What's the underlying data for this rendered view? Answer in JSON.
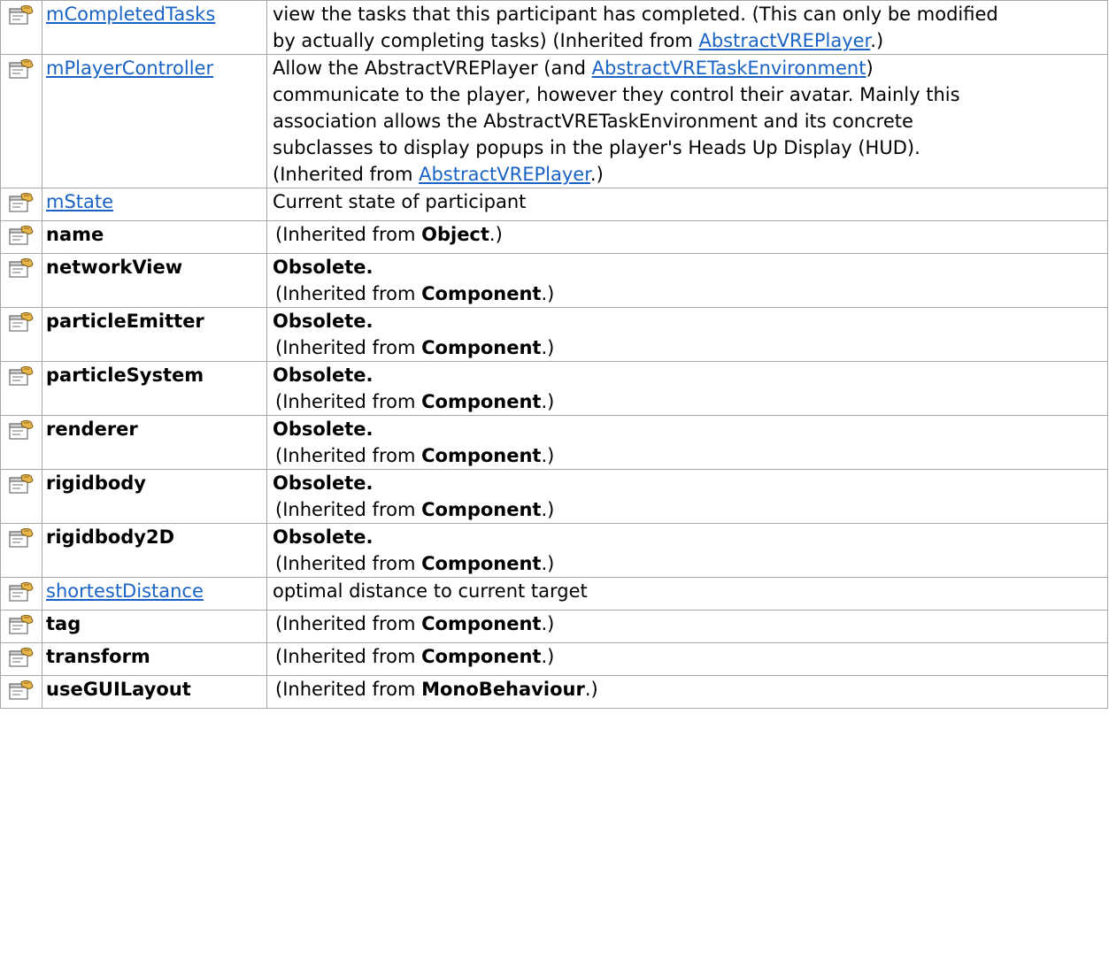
{
  "rows": [
    {
      "name": "mCompletedTasks",
      "link": true,
      "lines": [
        "view the tasks that this participant has completed. (This can only be modified",
        "by actually completing tasks) (Inherited from "
      ],
      "inherited_from": "AbstractVREPlayer",
      "inherited_link": true,
      "inherit_style": "inline-last"
    },
    {
      "name": "mPlayerController",
      "link": true,
      "lines": [
        "Allow the AbstractVREPlayer (and ",
        "communicate to the player, however they control their avatar. Mainly this",
        "association allows the AbstractVRETaskEnvironment and its concrete",
        "subclasses to display popups in the player's Heads Up Display (HUD).",
        "(Inherited from "
      ],
      "inline_link": "AbstractVRETaskEnvironment",
      "inherited_from": "AbstractVREPlayer",
      "inherited_link": true,
      "inherit_style": "special"
    },
    {
      "name": "mState",
      "link": true,
      "lines": [
        "Current state of participant"
      ]
    },
    {
      "name": "name",
      "link": false,
      "obsolete": false,
      "inherited_from": "Object"
    },
    {
      "name": "networkView",
      "link": false,
      "obsolete": true,
      "inherited_from": "Component"
    },
    {
      "name": "particleEmitter",
      "link": false,
      "obsolete": true,
      "inherited_from": "Component"
    },
    {
      "name": "particleSystem",
      "link": false,
      "obsolete": true,
      "inherited_from": "Component"
    },
    {
      "name": "renderer",
      "link": false,
      "obsolete": true,
      "inherited_from": "Component"
    },
    {
      "name": "rigidbody",
      "link": false,
      "obsolete": true,
      "inherited_from": "Component"
    },
    {
      "name": "rigidbody2D",
      "link": false,
      "obsolete": true,
      "inherited_from": "Component"
    },
    {
      "name": "shortestDistance",
      "link": true,
      "lines": [
        "optimal distance to current target"
      ]
    },
    {
      "name": "tag",
      "link": false,
      "obsolete": false,
      "inherited_from": "Component"
    },
    {
      "name": "transform",
      "link": false,
      "obsolete": false,
      "inherited_from": "Component"
    },
    {
      "name": "useGUILayout",
      "link": false,
      "obsolete": false,
      "inherited_from": "MonoBehaviour"
    }
  ],
  "labels": {
    "obsolete": "Obsolete.",
    "inherited_prefix": "(Inherited from ",
    "inherited_suffix": ".)",
    "close_paren": ")"
  },
  "colors": {
    "link": "#1a63c6",
    "border": "#a8a8a8"
  },
  "icon": "property-icon"
}
